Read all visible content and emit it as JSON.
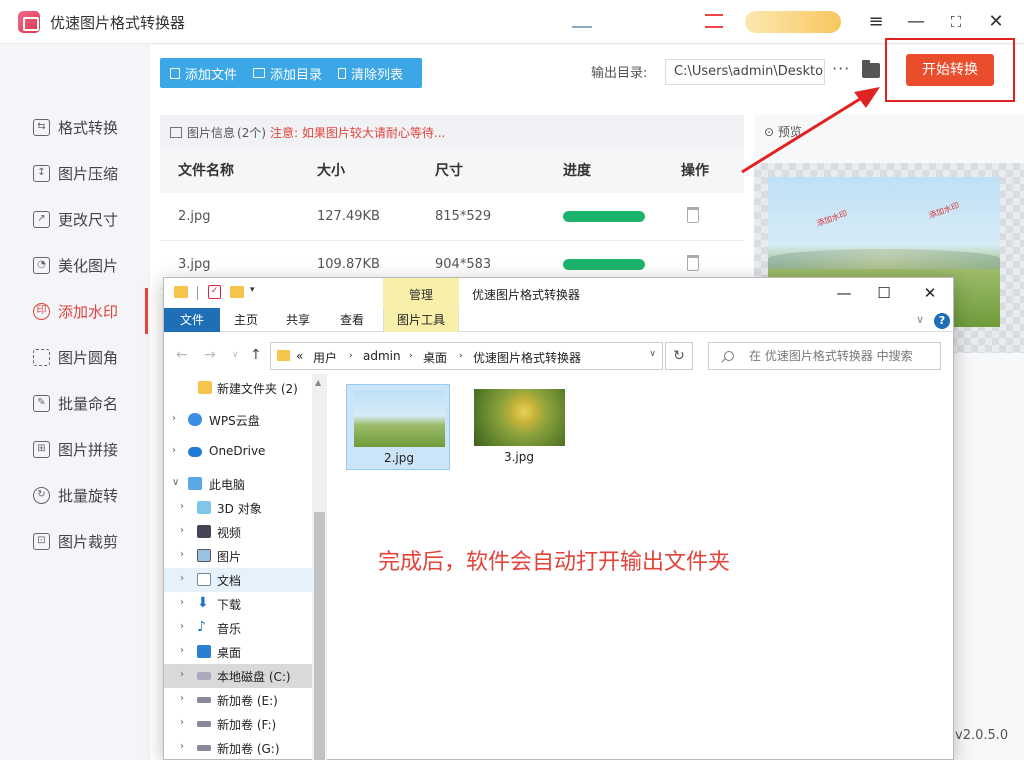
{
  "app": {
    "title": "优速图片格式转换器",
    "version": "v2.0.5.0",
    "accent": "#e2443b"
  },
  "sidebar": {
    "items": [
      {
        "label": "格式转换",
        "icon": "convert-icon"
      },
      {
        "label": "图片压缩",
        "icon": "compress-icon"
      },
      {
        "label": "更改尺寸",
        "icon": "resize-icon"
      },
      {
        "label": "美化图片",
        "icon": "beautify-icon"
      },
      {
        "label": "添加水印",
        "icon": "watermark-icon",
        "active": true
      },
      {
        "label": "图片圆角",
        "icon": "round-corner-icon"
      },
      {
        "label": "批量命名",
        "icon": "rename-icon"
      },
      {
        "label": "图片拼接",
        "icon": "stitch-icon"
      },
      {
        "label": "批量旋转",
        "icon": "rotate-icon"
      },
      {
        "label": "图片裁剪",
        "icon": "crop-icon"
      }
    ]
  },
  "toolbar": {
    "add_file": "添加文件",
    "add_dir": "添加目录",
    "clear_list": "清除列表",
    "output_label": "输出目录:",
    "output_path": "C:\\Users\\admin\\Deskto",
    "more": "···",
    "start": "开始转换"
  },
  "info": {
    "title": "图片信息",
    "count": "(2个)",
    "note": "注意: 如果图片较大请耐心等待..."
  },
  "table": {
    "headers": [
      "文件名称",
      "大小",
      "尺寸",
      "进度",
      "操作"
    ],
    "rows": [
      {
        "name": "2.jpg",
        "size": "127.49KB",
        "dims": "815*529",
        "progress": 1.0
      },
      {
        "name": "3.jpg",
        "size": "109.87KB",
        "dims": "904*583",
        "progress": 1.0
      }
    ]
  },
  "preview": {
    "label": "预览",
    "watermark": "添加水印"
  },
  "explorer": {
    "manage_tab": "管理",
    "title": "优速图片格式转换器",
    "ribbon_tabs": [
      "文件",
      "主页",
      "共享",
      "查看",
      "图片工具"
    ],
    "address": {
      "prefix": "«",
      "crumbs": [
        "用户",
        "admin",
        "桌面",
        "优速图片格式转换器"
      ]
    },
    "search_placeholder": "在 优速图片格式转换器 中搜索",
    "nav": [
      {
        "label": "新建文件夹 (2)",
        "type": "folder"
      },
      {
        "label": "WPS云盘",
        "type": "cloud"
      },
      {
        "label": "OneDrive",
        "type": "cloud"
      },
      {
        "label": "此电脑",
        "type": "pc"
      },
      {
        "label": "3D 对象",
        "type": "3d"
      },
      {
        "label": "视频",
        "type": "video"
      },
      {
        "label": "图片",
        "type": "pictures"
      },
      {
        "label": "文档",
        "type": "docs"
      },
      {
        "label": "下载",
        "type": "download"
      },
      {
        "label": "音乐",
        "type": "music"
      },
      {
        "label": "桌面",
        "type": "desktop"
      },
      {
        "label": "本地磁盘 (C:)",
        "type": "drive"
      },
      {
        "label": "新加卷 (E:)",
        "type": "drive"
      },
      {
        "label": "新加卷 (F:)",
        "type": "drive"
      },
      {
        "label": "新加卷 (G:)",
        "type": "drive"
      }
    ],
    "files": [
      {
        "name": "2.jpg"
      },
      {
        "name": "3.jpg"
      }
    ]
  },
  "annotation": "完成后，软件会自动打开输出文件夹"
}
